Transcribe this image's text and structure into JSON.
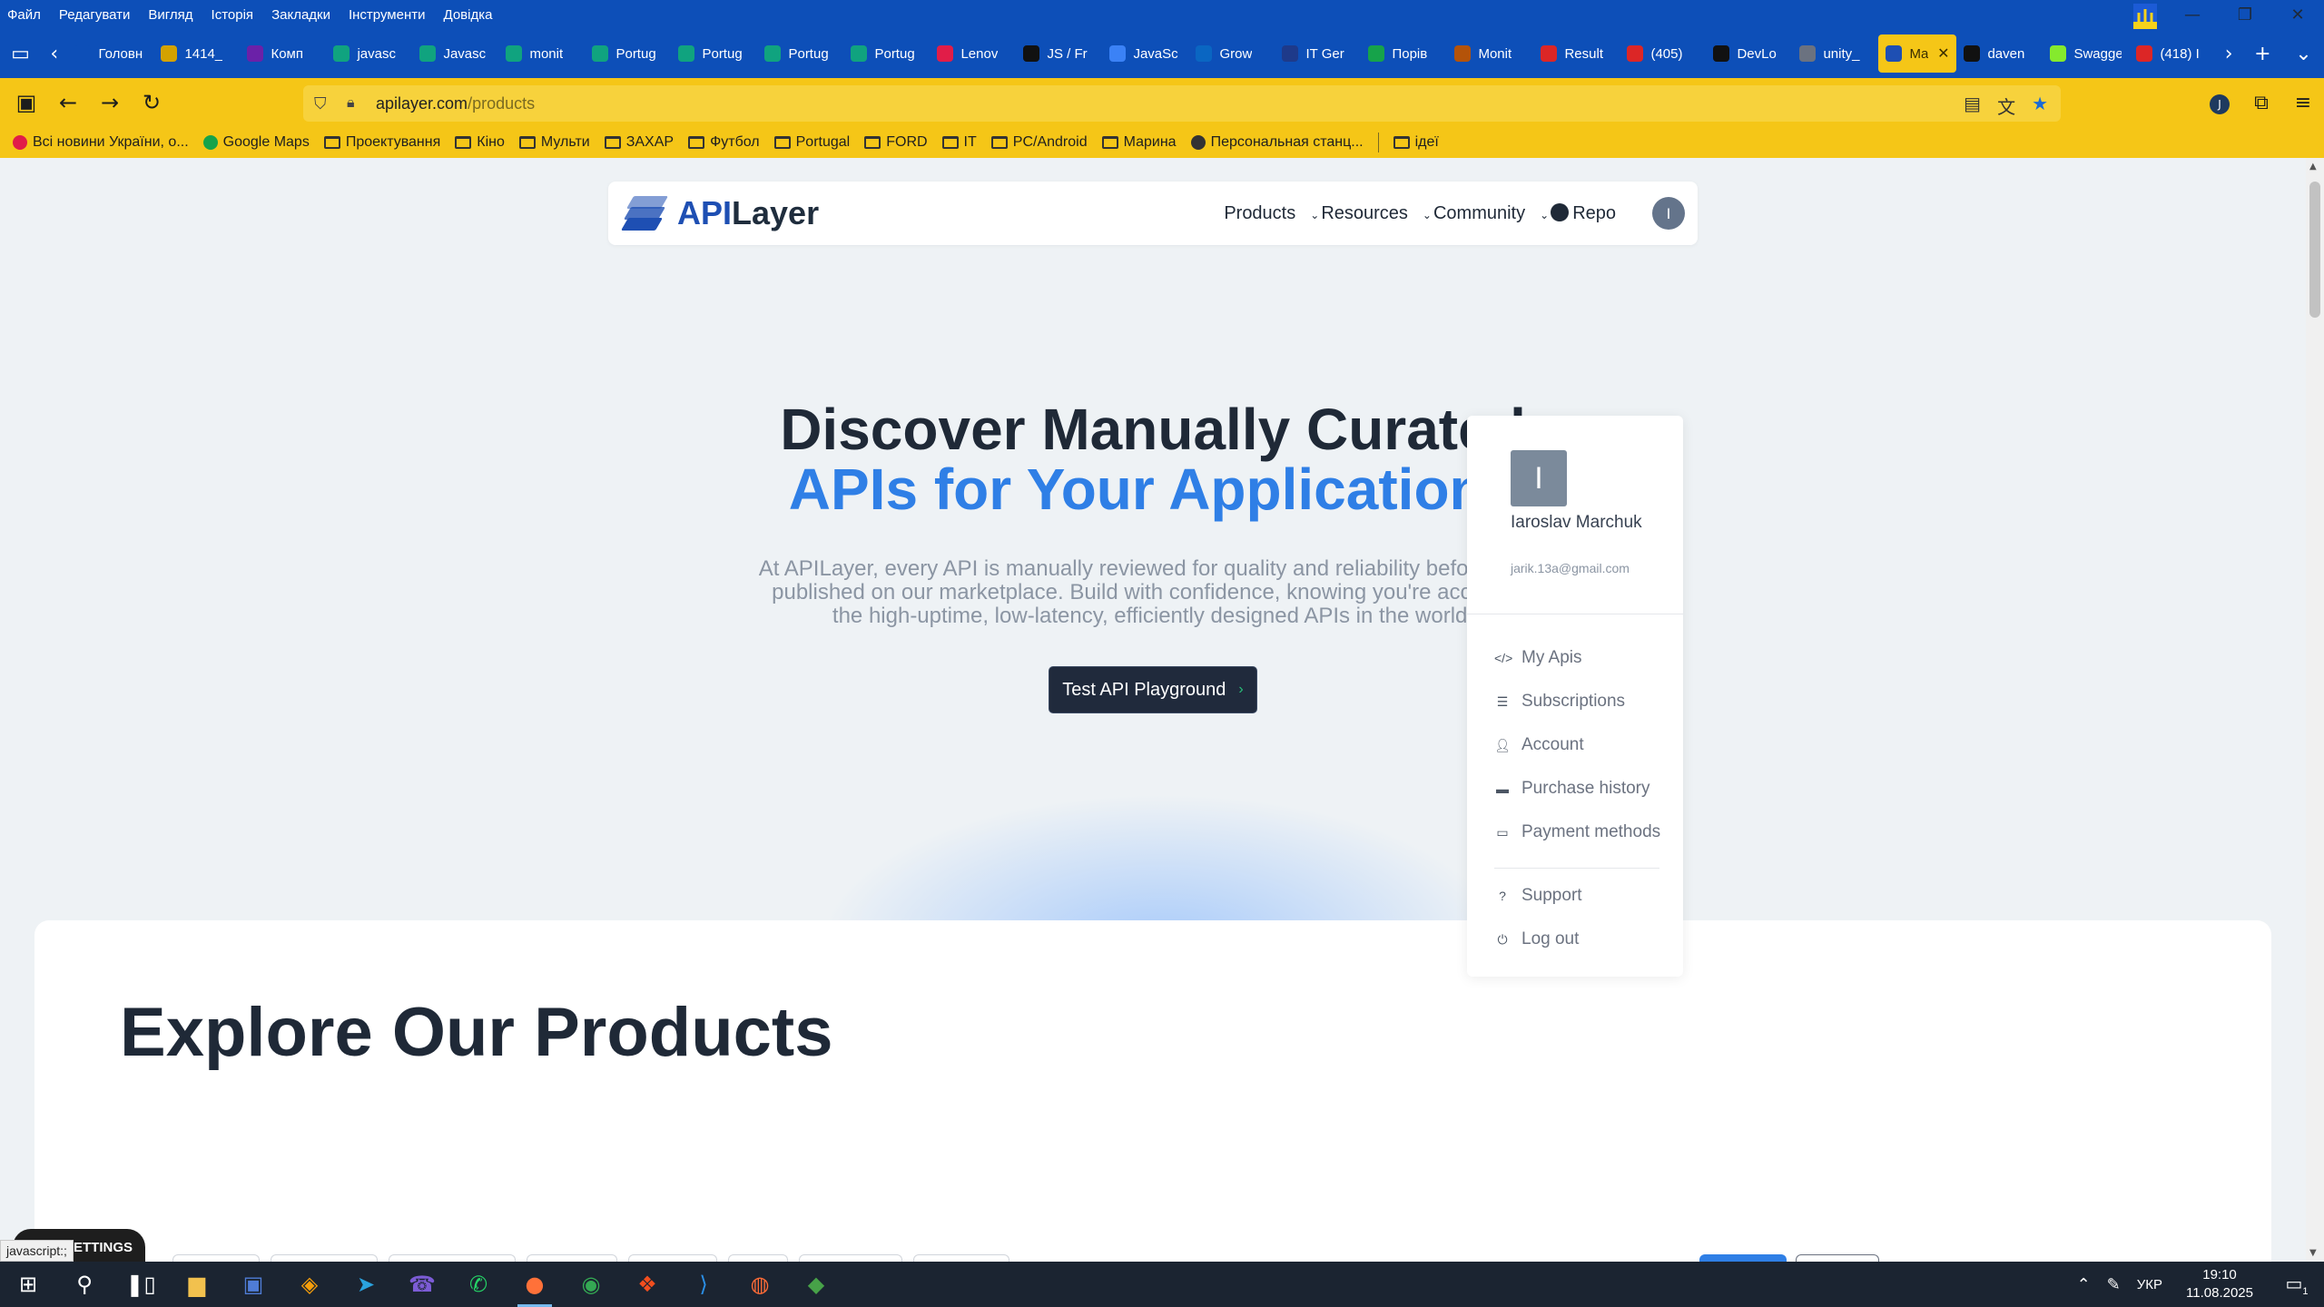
{
  "browser": {
    "menu": [
      "Файл",
      "Редагувати",
      "Вигляд",
      "Історія",
      "Закладки",
      "Інструменти",
      "Довідка"
    ],
    "tabs": [
      {
        "label": "Головн",
        "color": "#0d4fb8"
      },
      {
        "label": "1414_",
        "color": "#d4a200"
      },
      {
        "label": "Комп",
        "color": "#6b21a8"
      },
      {
        "label": "javasc",
        "color": "#10a37f"
      },
      {
        "label": "Javasc",
        "color": "#10a37f"
      },
      {
        "label": "monit",
        "color": "#10a37f"
      },
      {
        "label": "Portug",
        "color": "#10a37f"
      },
      {
        "label": "Portug",
        "color": "#10a37f"
      },
      {
        "label": "Portug",
        "color": "#10a37f"
      },
      {
        "label": "Portug",
        "color": "#10a37f"
      },
      {
        "label": "Lenov",
        "color": "#e11d48"
      },
      {
        "label": "JS / Fr",
        "color": "#111111"
      },
      {
        "label": "JavaSc",
        "color": "#3b82f6"
      },
      {
        "label": "Grow",
        "color": "#0a66c2"
      },
      {
        "label": "IT Ger",
        "color": "#1e3a8a"
      },
      {
        "label": "Порів",
        "color": "#16a34a"
      },
      {
        "label": "Monit",
        "color": "#b45309"
      },
      {
        "label": "Result",
        "color": "#dc2626"
      },
      {
        "label": "(405)",
        "color": "#dc2626"
      },
      {
        "label": "DevLo",
        "color": "#111111"
      },
      {
        "label": "unity_",
        "color": "#6b7280"
      },
      {
        "label": "Ma",
        "color": "#1e4fb3",
        "active": true
      },
      {
        "label": "daven",
        "color": "#111111"
      },
      {
        "label": "Swagger U",
        "color": "#85ea2d"
      },
      {
        "label": "(418) I",
        "color": "#dc2626"
      }
    ],
    "url_host": "apilayer.com",
    "url_path": "/products",
    "bookmarks": [
      {
        "label": "Всі новини України, о...",
        "type": "fav",
        "color": "#e11d48"
      },
      {
        "label": "Google Maps",
        "type": "fav",
        "color": "#16a34a"
      },
      {
        "label": "Проектування",
        "type": "folder"
      },
      {
        "label": "Кіно",
        "type": "folder"
      },
      {
        "label": "Мульти",
        "type": "folder"
      },
      {
        "label": "ЗАХАР",
        "type": "folder"
      },
      {
        "label": "Футбол",
        "type": "folder"
      },
      {
        "label": "Portugal",
        "type": "folder"
      },
      {
        "label": "FORD",
        "type": "folder"
      },
      {
        "label": "IT",
        "type": "folder"
      },
      {
        "label": "PC/Android",
        "type": "folder"
      },
      {
        "label": "Марина",
        "type": "folder"
      },
      {
        "label": "Персональная станц...",
        "type": "fav",
        "color": "#333333"
      }
    ],
    "bookmark_extra": "ідеї"
  },
  "site": {
    "logo_api": "API",
    "logo_layer": "Layer",
    "nav": {
      "products": "Products",
      "resources": "Resources",
      "community": "Community",
      "repo": "Repo"
    },
    "avatar_initial": "I",
    "hero_line1": "Discover Manually Curated",
    "hero_line2": "APIs for Your Applications",
    "hero_desc_1": "At APILayer, every API is manually reviewed for quality and reliability before being",
    "hero_desc_2": "published on our marketplace. Build with confidence, knowing you're accessing",
    "hero_desc_3": "the high-uptime, low-latency, efficiently designed APIs in the world.",
    "cta_label": "Test API Playground",
    "products_title": "Explore Our Products"
  },
  "user_menu": {
    "initial": "I",
    "name": "Iaroslav Marchuk",
    "email": "jarik.13a@gmail.com",
    "items": [
      {
        "label": "My Apis",
        "icon": "code-icon"
      },
      {
        "label": "Subscriptions",
        "icon": "list-icon"
      },
      {
        "label": "Account",
        "icon": "user-icon"
      },
      {
        "label": "Purchase history",
        "icon": "money-icon"
      },
      {
        "label": "Payment methods",
        "icon": "credit-card-icon"
      },
      {
        "label": "Support",
        "icon": "help-icon"
      },
      {
        "label": "Log out",
        "icon": "power-icon"
      }
    ]
  },
  "overlay": {
    "settings_label": "SETTINGS",
    "status_url": "javascript:;"
  },
  "taskbar": {
    "language": "УКР",
    "time": "19:10",
    "date": "11.08.2025",
    "notif_count": "1",
    "apps": [
      "start-icon",
      "search-icon",
      "task-view-icon",
      "file-explorer-icon",
      "save-icon",
      "sublime-icon",
      "telegram-icon",
      "viber-icon",
      "whatsapp-icon",
      "firefox-icon",
      "chrome-icon",
      "figma-icon",
      "vscode-icon",
      "postman-icon",
      "mongodb-icon"
    ]
  }
}
